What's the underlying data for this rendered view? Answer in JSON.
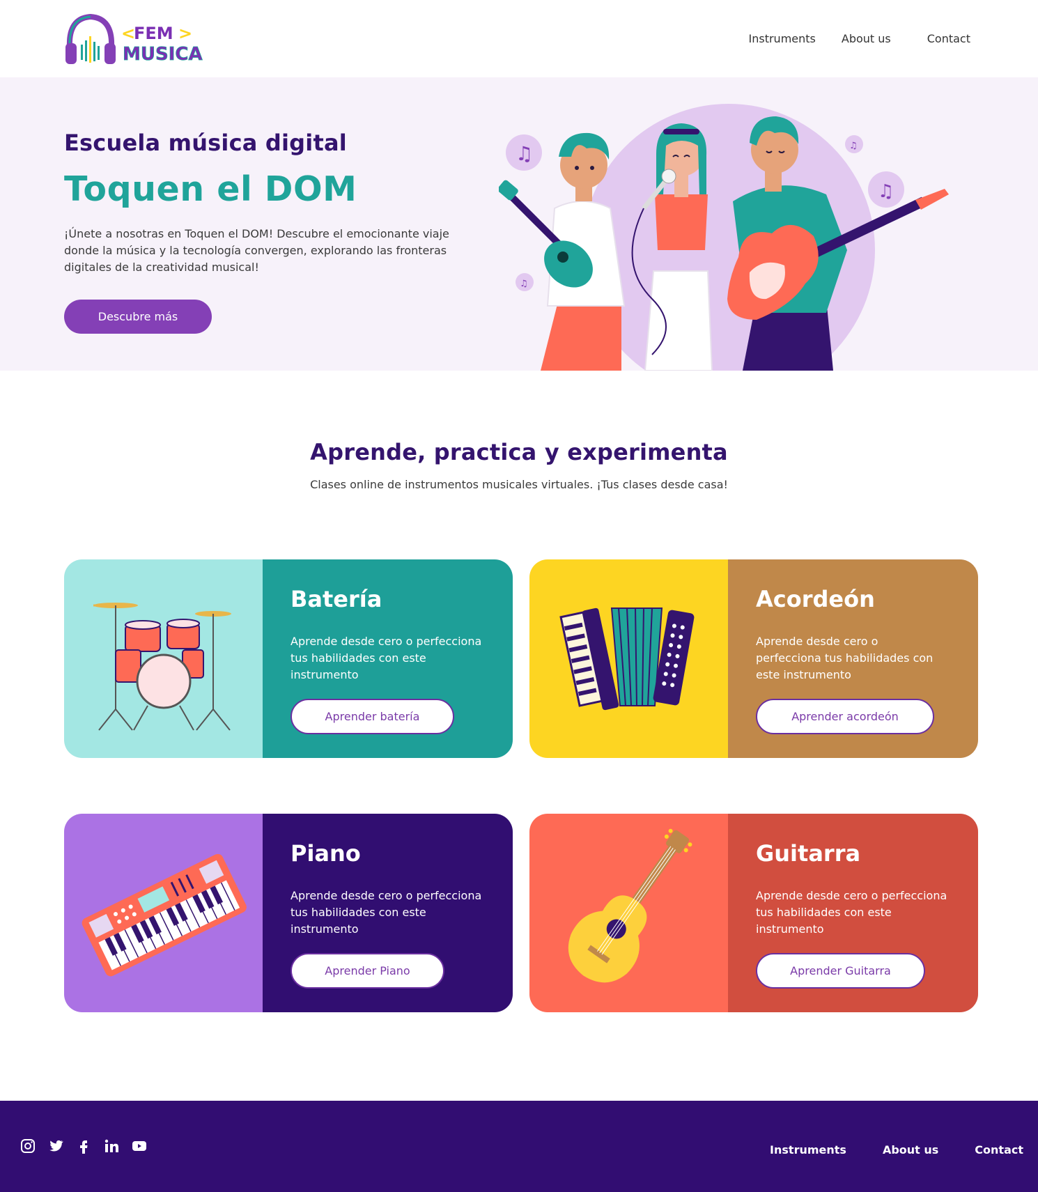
{
  "brand": {
    "logo_line1": "<FEM>",
    "logo_line2": "MUSICA"
  },
  "nav": {
    "items": [
      "Instruments",
      "About us",
      "Contact"
    ]
  },
  "hero": {
    "subtitle": "Escuela música digital",
    "title": "Toquen el DOM",
    "text": "¡Únete a nosotras en Toquen el DOM! Descubre el emocionante viaje donde la música y la tecnología convergen, explorando las fronteras digitales de la creatividad musical!",
    "button": "Descubre más"
  },
  "section": {
    "title": "Aprende, practica y experimenta",
    "subtitle": "Clases online de instrumentos musicales virtuales. ¡Tus clases desde casa!"
  },
  "cards": [
    {
      "title": "Batería",
      "description": "Aprende desde cero o perfecciona tus habilidades con este instrumento",
      "button": "Aprender batería",
      "art_color": "#a3e7e3",
      "body_color": "#1e9f98"
    },
    {
      "title": "Acordeón",
      "description": "Aprende desde cero o perfecciona tus habilidades con este instrumento",
      "button": "Aprender acordeón",
      "art_color": "#fdd522",
      "body_color": "#c0884a"
    },
    {
      "title": "Piano",
      "description": "Aprende desde cero o perfecciona tus habilidades con este instrumento",
      "button": "Aprender Piano",
      "art_color": "#ab72e4",
      "body_color": "#310e71"
    },
    {
      "title": "Guitarra",
      "description": "Aprende desde cero o perfecciona tus habilidades con este instrumento",
      "button": "Aprender Guitarra",
      "art_color": "#fe6a55",
      "body_color": "#d14e3f"
    }
  ],
  "footer": {
    "socials": [
      "instagram-icon",
      "twitter-icon",
      "facebook-icon",
      "linkedin-icon",
      "youtube-icon"
    ],
    "nav": [
      "Instruments",
      "About us",
      "Contact"
    ],
    "background": "#320d72"
  },
  "colors": {
    "primary_purple": "#8440b6",
    "dark_purple": "#34146e",
    "teal": "#20a49a",
    "hero_bg": "#f7f2fa"
  }
}
